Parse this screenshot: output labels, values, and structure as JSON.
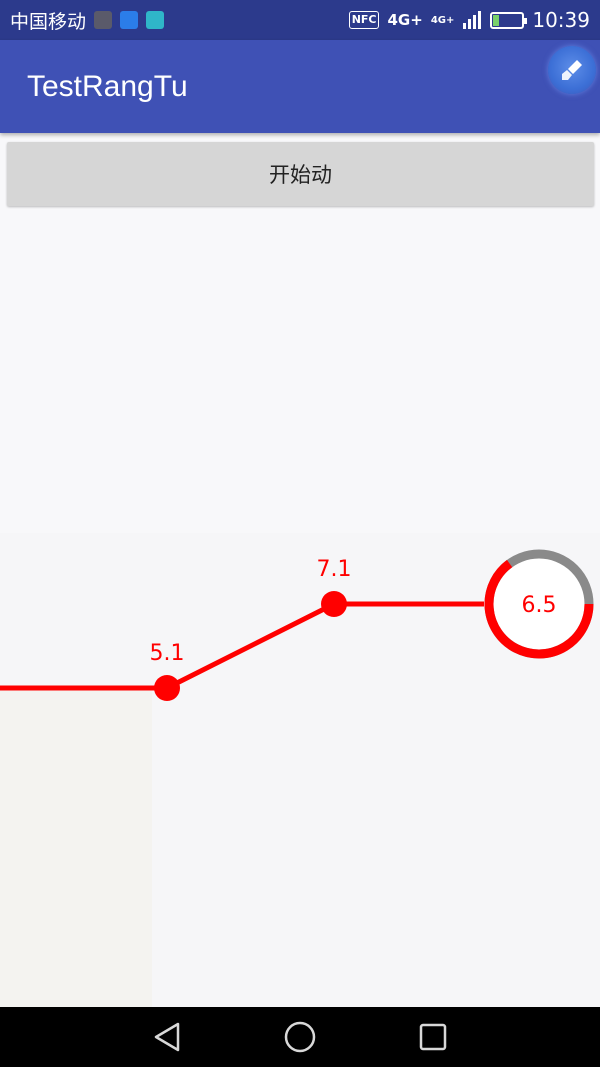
{
  "status_bar": {
    "carrier": "中国移动",
    "nfc": "NFC",
    "network": "4G+",
    "network2": "4G+",
    "time": "10:39",
    "icons": [
      "huawei-app-icon",
      "blue-app-icon",
      "cyan-app-icon",
      "nfc-icon",
      "signal-icon",
      "battery-charging-icon"
    ]
  },
  "app_bar": {
    "title": "TestRangTu",
    "floating_icon": "clean-brush-icon"
  },
  "main": {
    "start_button_label": "开始动"
  },
  "chart_data": {
    "type": "line",
    "x": [
      1,
      2,
      3
    ],
    "values": [
      5.1,
      7.1,
      6.5
    ],
    "point_labels": [
      "5.1",
      "7.1",
      "6.5"
    ],
    "highlight": {
      "label": "6.5",
      "progress": 0.65
    },
    "colors": {
      "line": "#ff0000",
      "ring_track": "#8a8a8a",
      "label": "#ff0000"
    }
  },
  "nav_bar": {
    "icons": [
      "back-triangle-icon",
      "home-circle-icon",
      "recents-square-icon"
    ]
  }
}
